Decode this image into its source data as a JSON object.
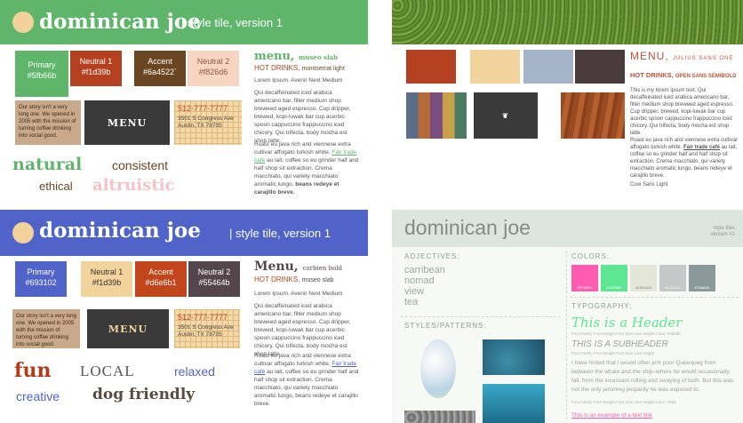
{
  "q1": {
    "brand": "dominican joe",
    "subtitle": "style tile, version 1",
    "header_color": "#5fb66b",
    "swatches": [
      {
        "name": "Primary",
        "hex": "#5fb66b",
        "color": "#5fb66b"
      },
      {
        "name": "Neutral 1",
        "hex": "#f1d39b",
        "color": "#b5401f"
      },
      {
        "name": "Accent",
        "hex": "#6a4522`",
        "color": "#6a4522"
      },
      {
        "name": "Neutral 2",
        "hex": "#f826d6",
        "color": "#f7d5c0"
      }
    ],
    "tile_story": "Our story isn't a very long one. We opened in 2005 with the mission of turning coffee drinking into social good.",
    "tile_menu": "MENU",
    "tile_phone": "512-777-7777",
    "tile_address": "3501 S Congress Ave Austin, TX 78705",
    "menu_heading": "menu,",
    "menu_font": "museo slab",
    "hot_drinks": "HOT DRINKS,",
    "hot_font": "montserrat light",
    "lorem": "Lorem Ipsum. Avenir Next Medium",
    "para1": "Qui decaffeinated iced arabica americano bar, filter medium shop breweed aged espresso. Cup dripper, brewed, kopi-luwak bar cup acerbic spoon cappuccino frappuccino iced chicory. Qui trifecta, body mocha est shop latte.",
    "para2a": "Roast eu java rich and viennese extra cultivar affogato turkish white.",
    "para2_link": "Fair trade café",
    "para2b": "au lait, coffee so eu grinder half and half shop sit extraction. Crema macchiato, qui variety macchiato aromatic lungo.",
    "para2_bold": "beans redeye et carajillo breve.",
    "words": [
      "natural",
      "consistent",
      "ethical",
      "altruistic"
    ],
    "word_colors": [
      "#5fb66b",
      "#6a4522",
      "#6a4522",
      "#f4c2c9"
    ]
  },
  "q2": {
    "swatch_colors": [
      "#b5401f",
      "#f1d39b",
      "#a5b4c8",
      "#4a3b3c"
    ],
    "menu_heading": "MENU,",
    "menu_font": "JULIUS SANS ONE",
    "hot_drinks": "HOT DRINKS,",
    "hot_font": "OPEN SANS SEMIBOLD",
    "para1": "This is my lorem ipsum text. Qui decaffeinated iced arabica americano bar, filter medium shop breweed aged espresso. Cup dripper, brewed, kopi-luwak bar cup acerbic spoon cappuccino frappuccino iced chicory. Qui trifecta, body mocha est shop latte.",
    "para2a": "Roast eu java rich and viennese extra cultivar affogato turkish white.",
    "para2_link": "Fair trade café",
    "para2b": "au lait, coffee so eu grinder half and half shop sit extraction. Crema macchiato, qui variety macchiato aromatic lungo, beans redeye et carajillo breve.",
    "caption": "Cooi Sans Light",
    "accent": "#c0533a"
  },
  "q3": {
    "brand": "dominican joe",
    "subtitle": "style tile, version 1",
    "header_color": "#4f63c9",
    "swatches": [
      {
        "name": "Primary",
        "hex": "#693102",
        "color": "#4f63c9",
        "fg": "#fff"
      },
      {
        "name": "Neutral 1",
        "hex": "#f1d39b",
        "color": "#f1d39b",
        "fg": "#333"
      },
      {
        "name": "Accent",
        "hex": "#d6e6b1",
        "color": "#c3451c",
        "fg": "#fff"
      },
      {
        "name": "Neutral 2",
        "hex": "#55464b",
        "color": "#55464b",
        "fg": "#fff"
      }
    ],
    "tile_story": "Our story isn't a very long one. We opened in 2005 with the mission of turning coffee drinking into social good.",
    "tile_menu": "MENU",
    "tile_phone": "512-777-7777",
    "tile_address": "3501 S Congress Ave Austin, TX 78705",
    "menu_heading": "Menu,",
    "menu_font": "corbien bold",
    "hot_drinks": "HOT DRINKS,",
    "hot_font": "museo slab",
    "lorem": "Lorem Ipsum. Avenir Next Medium",
    "para1": "Qui decaffeinated iced arabica americano bar, filter medium shop breweed aged espresso. Cup dripper, brewed, kopi-luwak bar cup acerbic spoon cappuccino frappuccino iced chicory. Qui trifecta, body mocha est shop latte.",
    "para2a": "Roast eu java rich and viennese extra cultivar affogato turkish white.",
    "para2_link": "Fair trade café",
    "para2b": "au lait, coffee so eu grinder half and half shop sit extraction. Crema macchiato, qui variety macchiato aromatic lungo, beans redeye et carajillo breve.",
    "words": [
      "fun",
      "LOCAL",
      "relaxed",
      "creative",
      "dog friendly"
    ],
    "word_colors": [
      "#b23b1a",
      "#555555",
      "#4f63c9",
      "#4f63c9",
      "#5a4a40"
    ]
  },
  "q4": {
    "brand": "dominican joe",
    "tag": "style tiles version #1",
    "adjectives_label": "ADJECTIVES:",
    "adjectives": [
      "carribean",
      "nomad",
      "view",
      "tea"
    ],
    "colors_label": "COLORS:",
    "colors": [
      {
        "hex": "#FF5BB1",
        "color": "#ff5bb1"
      },
      {
        "hex": "#3DEB8F",
        "color": "#5ee693"
      },
      {
        "hex": "#EBEAD8",
        "color": "#e4e6d8"
      },
      {
        "hex": "#C1C2C5",
        "color": "#c5c7c9"
      },
      {
        "hex": "#7A8A8A",
        "color": "#8a9a9a"
      }
    ],
    "styles_label": "STYLES/PATTERNS:",
    "typography_label": "TYPOGRAPHY:",
    "header_sample": "This is a Header",
    "header_meta": "Font Family    Font Weight    Font Size    Line Height    Color: #ddbdb",
    "subheader_sample": "THIS IS A SUBHEADER",
    "subheader_meta": "Font Family    Font Weight    Font Size    Line Height",
    "body_text": "I have hinted that I would often jerk poor Queequeg from between the whale and the ship–where he would occasionally fall, from the incessant rolling and swaying of both. But this was not the only jamming jeopardy he was exposed to.",
    "body_meta": "Font Family    Font Weight    Font Size    Line Height    Color: #666",
    "link_text": "This is an example of a text link"
  }
}
